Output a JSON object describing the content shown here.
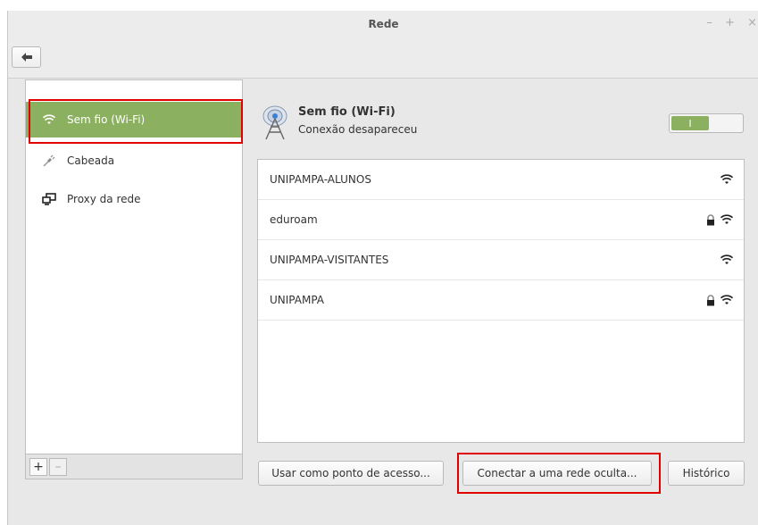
{
  "window": {
    "title": "Rede",
    "controls": [
      "–",
      "+",
      "×"
    ]
  },
  "sidebar": {
    "items": [
      {
        "label": "Sem fio (Wi-Fi)",
        "icon": "wifi-icon",
        "selected": true
      },
      {
        "label": "Cabeada",
        "icon": "wired-plug-icon",
        "selected": false
      },
      {
        "label": "Proxy da rede",
        "icon": "proxy-network-icon",
        "selected": false
      }
    ],
    "add_label": "+",
    "remove_label": "–"
  },
  "header": {
    "icon": "wireless-antenna-icon",
    "title": "Sem fio (Wi-Fi)",
    "subtitle": "Conexão desapareceu",
    "toggle_label": "I",
    "toggle_on": true
  },
  "networks": [
    {
      "name": "UNIPAMPA-ALUNOS",
      "secured": false
    },
    {
      "name": "eduroam",
      "secured": true
    },
    {
      "name": "UNIPAMPA-VISITANTES",
      "secured": false
    },
    {
      "name": "UNIPAMPA",
      "secured": true
    }
  ],
  "buttons": {
    "hotspot_label": "Usar como ponto de acesso...",
    "hidden_label": "Conectar a uma rede oculta...",
    "history_label": "Histórico"
  },
  "colors": {
    "accent": "#8bb060",
    "highlight": "#e00000"
  }
}
